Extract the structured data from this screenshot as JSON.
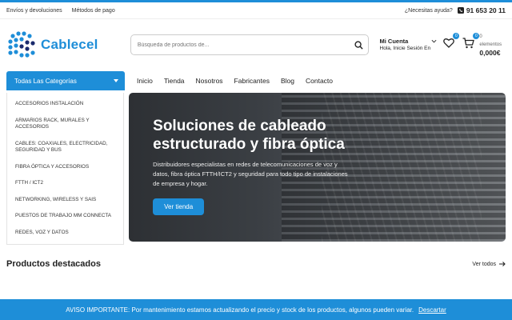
{
  "topbar": {
    "links": [
      "Envíos y devoluciones",
      "Métodos de pago"
    ],
    "help": "¿Necesitas ayuda?",
    "phone": "91 653 20 11"
  },
  "brand": {
    "name": "Cablecel",
    "color": "#1e8ed8"
  },
  "search": {
    "placeholder": "Búsqueda de productos de..."
  },
  "account": {
    "title": "Mi Cuenta",
    "subtitle": "Hola, Inicie Sesión En"
  },
  "wishlist": {
    "count": "0"
  },
  "cart": {
    "count": "0",
    "items_label": "0 elementos",
    "total": "0,000€"
  },
  "categories": {
    "button_label": "Todas Las Categorías",
    "items": [
      "ACCESORIOS INSTALACIÓN",
      "ARMARIOS RACK, MURALES Y ACCESORIOS",
      "CABLES: COAXIALES, ELECTRICIDAD, SEGURIDAD Y BUS",
      "FIBRA ÓPTICA Y ACCESORIOS",
      "FTTH / ICT2",
      "NETWORKING, WIRELESS Y SAIS",
      "PUESTOS DE TRABAJO MM CONNECTA",
      "REDES, VOZ Y DATOS"
    ]
  },
  "nav": [
    "Inicio",
    "Tienda",
    "Nosotros",
    "Fabricantes",
    "Blog",
    "Contacto"
  ],
  "hero": {
    "title": "Soluciones de cableado estructurado y fibra óptica",
    "description": "Distribuidores especialistas en redes de telecomunicaciones de voz y datos, fibra óptica FTTH/ICT2 y seguridad para todo tipo de instalaciones de empresa y hogar.",
    "cta": "Ver tienda"
  },
  "featured": {
    "title": "Productos destacados",
    "see_all": "Ver todos"
  },
  "notice": {
    "text": "AVISO IMPORTANTE: Por mantenimiento estamos actualizando el precio y stock de los productos, algunos pueden variar.",
    "dismiss": "Descartar"
  }
}
